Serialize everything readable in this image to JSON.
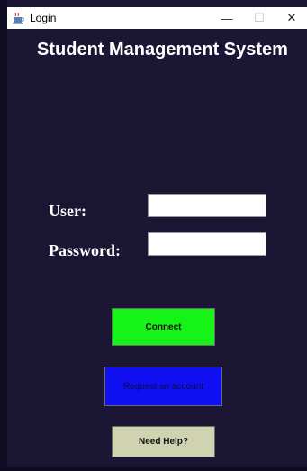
{
  "window": {
    "title": "Login",
    "minimize_glyph": "—",
    "maximize_glyph": "☐",
    "close_glyph": "✕"
  },
  "header": {
    "title": "Student Management System"
  },
  "form": {
    "user_label": "User:",
    "user_value": "",
    "password_label": "Password:",
    "password_value": ""
  },
  "buttons": {
    "connect_label": "Connect",
    "request_label": "Request an account",
    "help_label": "Need Help?"
  },
  "colors": {
    "background": "#1a1633",
    "connect": "#16f316",
    "request": "#0f0ff2",
    "help": "#cfd3b0"
  },
  "icons": {
    "app": "java-coffee-icon"
  }
}
